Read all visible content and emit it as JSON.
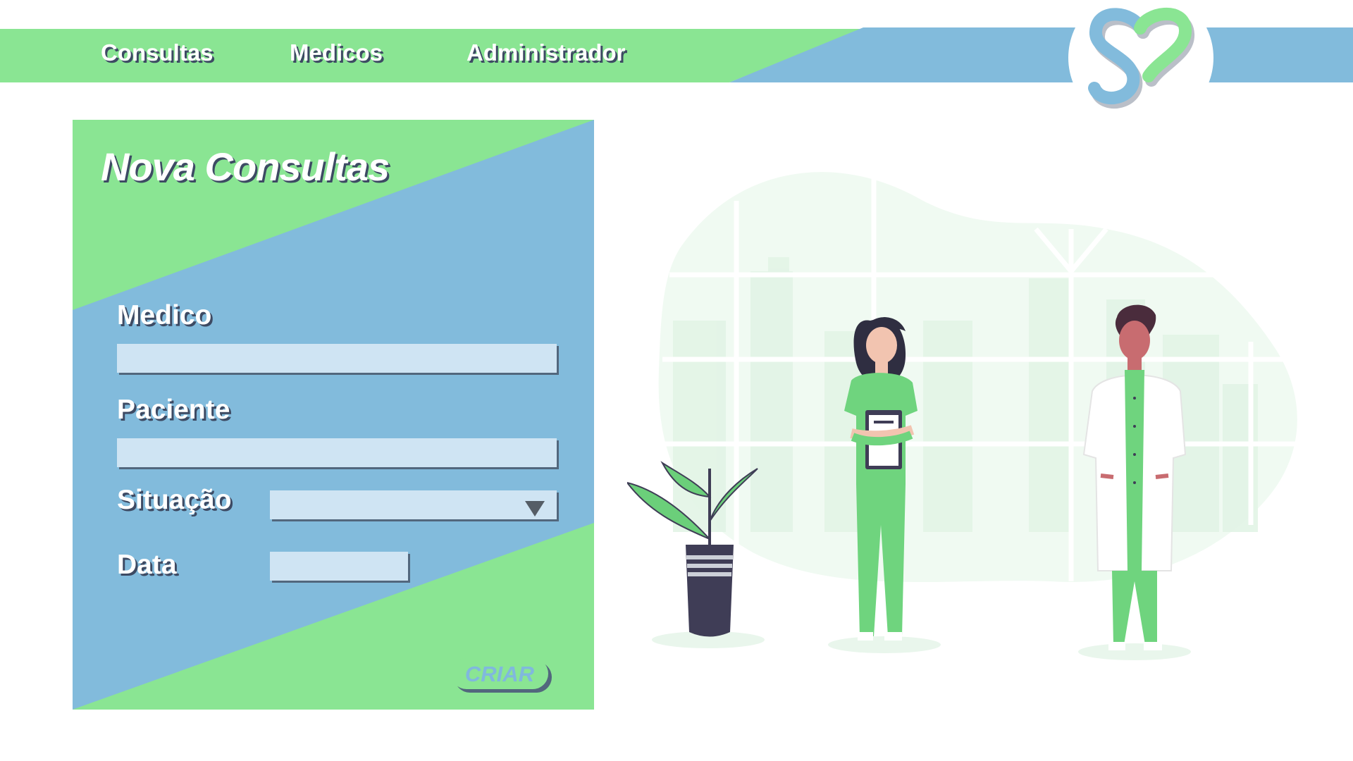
{
  "nav": {
    "items": [
      {
        "label": "Consultas"
      },
      {
        "label": "Medicos"
      },
      {
        "label": "Administrador"
      }
    ]
  },
  "logo": {
    "icon": "heart-s-logo-icon"
  },
  "form": {
    "title": "Nova Consultas",
    "fields": {
      "medico": {
        "label": "Medico",
        "value": ""
      },
      "paciente": {
        "label": "Paciente",
        "value": ""
      },
      "situacao": {
        "label": "Situação",
        "value": ""
      },
      "data": {
        "label": "Data",
        "value": ""
      }
    },
    "submit_label": "CRIAR"
  },
  "illustration": {
    "icon": "doctors-illustration-icon"
  },
  "colors": {
    "green": "#8ae593",
    "blue": "#82bbdc",
    "input": "#cfe4f3",
    "shadow": "#3d4a63",
    "dark": "#3f3d56"
  }
}
